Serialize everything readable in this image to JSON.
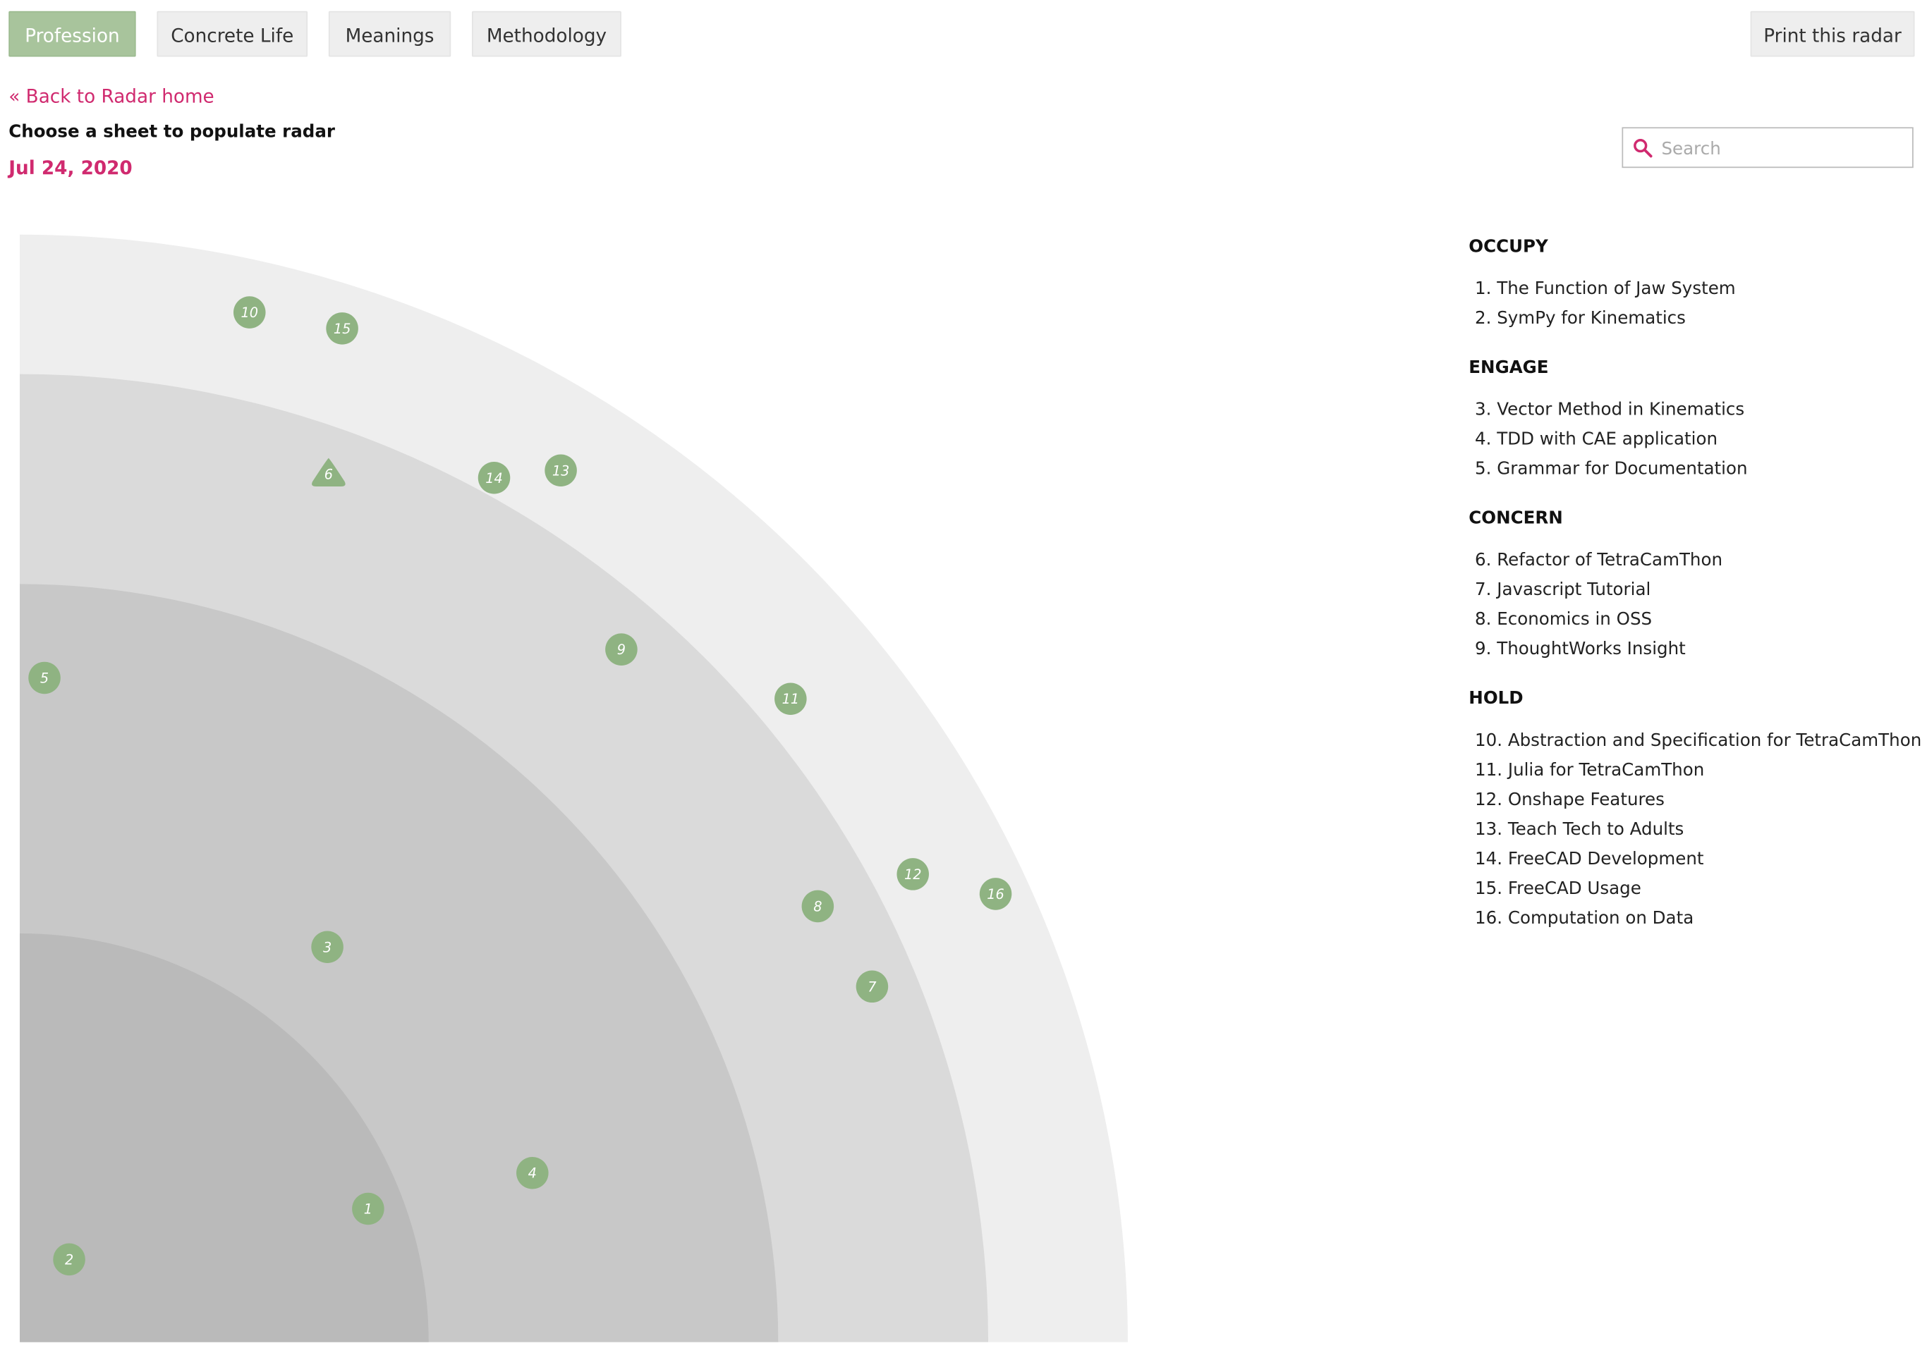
{
  "tabs": [
    {
      "label": "Profession",
      "active": true
    },
    {
      "label": "Concrete Life",
      "active": false
    },
    {
      "label": "Meanings",
      "active": false
    },
    {
      "label": "Methodology",
      "active": false
    }
  ],
  "print_label": "Print this radar",
  "back_link": "« Back to Radar home",
  "subtitle": "Choose a sheet to populate radar",
  "date": "Jul 24, 2020",
  "search": {
    "placeholder": "Search",
    "value": ""
  },
  "colors": {
    "accent": "#d02a6f",
    "blip": "#8fb382",
    "active_tab": "#a8c49c",
    "ring_colors": [
      "#bababa",
      "#c8c8c8",
      "#dadada",
      "#eeeeee"
    ]
  },
  "rings": [
    {
      "name": "OCCUPY",
      "items": [
        {
          "num": 1,
          "label": "1. The Function of Jaw System",
          "shape": "circle"
        },
        {
          "num": 2,
          "label": "2. SymPy for Kinematics",
          "shape": "circle"
        }
      ]
    },
    {
      "name": "ENGAGE",
      "items": [
        {
          "num": 3,
          "label": "3. Vector Method in Kinematics",
          "shape": "circle"
        },
        {
          "num": 4,
          "label": "4. TDD with CAE application",
          "shape": "circle"
        },
        {
          "num": 5,
          "label": "5. Grammar for Documentation",
          "shape": "circle"
        }
      ]
    },
    {
      "name": "CONCERN",
      "items": [
        {
          "num": 6,
          "label": "6. Refactor of TetraCamThon",
          "shape": "triangle"
        },
        {
          "num": 7,
          "label": "7. Javascript Tutorial",
          "shape": "circle"
        },
        {
          "num": 8,
          "label": "8. Economics in OSS",
          "shape": "circle"
        },
        {
          "num": 9,
          "label": "9. ThoughtWorks Insight",
          "shape": "circle"
        }
      ]
    },
    {
      "name": "HOLD",
      "items": [
        {
          "num": 10,
          "label": "10. Abstraction and Specification for TetraCamThon",
          "shape": "circle"
        },
        {
          "num": 11,
          "label": "11. Julia for TetraCamThon",
          "shape": "circle"
        },
        {
          "num": 12,
          "label": "12. Onshape Features",
          "shape": "circle"
        },
        {
          "num": 13,
          "label": "13. Teach Tech to Adults",
          "shape": "circle"
        },
        {
          "num": 14,
          "label": "14. FreeCAD Development",
          "shape": "circle"
        },
        {
          "num": 15,
          "label": "15. FreeCAD Usage",
          "shape": "circle"
        },
        {
          "num": 16,
          "label": "16. Computation on Data",
          "shape": "circle"
        }
      ]
    }
  ]
}
